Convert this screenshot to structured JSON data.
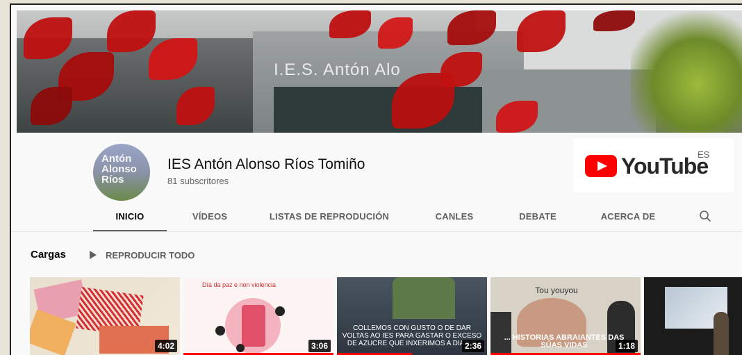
{
  "banner": {
    "sign_text": "I.E.S. Antón Alo"
  },
  "channel": {
    "avatar_text": [
      "Antón",
      "Alonso",
      "Ríos"
    ],
    "name": "IES Antón Alonso Ríos Tomiño",
    "subscribers": "81 subscritores"
  },
  "logo": {
    "wordmark": "YouTube",
    "region": "ES",
    "color": "#ff0000"
  },
  "tabs": [
    {
      "label": "INICIO",
      "active": true
    },
    {
      "label": "VÍDEOS",
      "active": false
    },
    {
      "label": "LISTAS DE REPRODUCIÓN",
      "active": false
    },
    {
      "label": "CANLES",
      "active": false
    },
    {
      "label": "DEBATE",
      "active": false
    },
    {
      "label": "ACERCA DE",
      "active": false
    }
  ],
  "search_icon": "search-icon",
  "shelf": {
    "title": "Cargas",
    "play_all_label": "REPRODUCIR TODO",
    "play_icon": "play-icon"
  },
  "videos": [
    {
      "duration": "4:02",
      "caption": ""
    },
    {
      "duration": "3:06",
      "caption": "Día da paz e non violencia",
      "progress": 1.0
    },
    {
      "duration": "2:36",
      "caption": "COLLEMOS CON GUSTO O DE DAR VOLTAS AO IES PARA GASTAR O EXCESO DE AZUCRE QUE INXERIMOS A DIARIO",
      "progress": 0.5
    },
    {
      "duration": "1:18",
      "caption": "... HISTORIAS ABRAIANTES DAS SÚAS VIDAS",
      "top_caption": "Tou youyou",
      "progress": 1.0
    },
    {
      "duration": "",
      "caption": ""
    }
  ]
}
